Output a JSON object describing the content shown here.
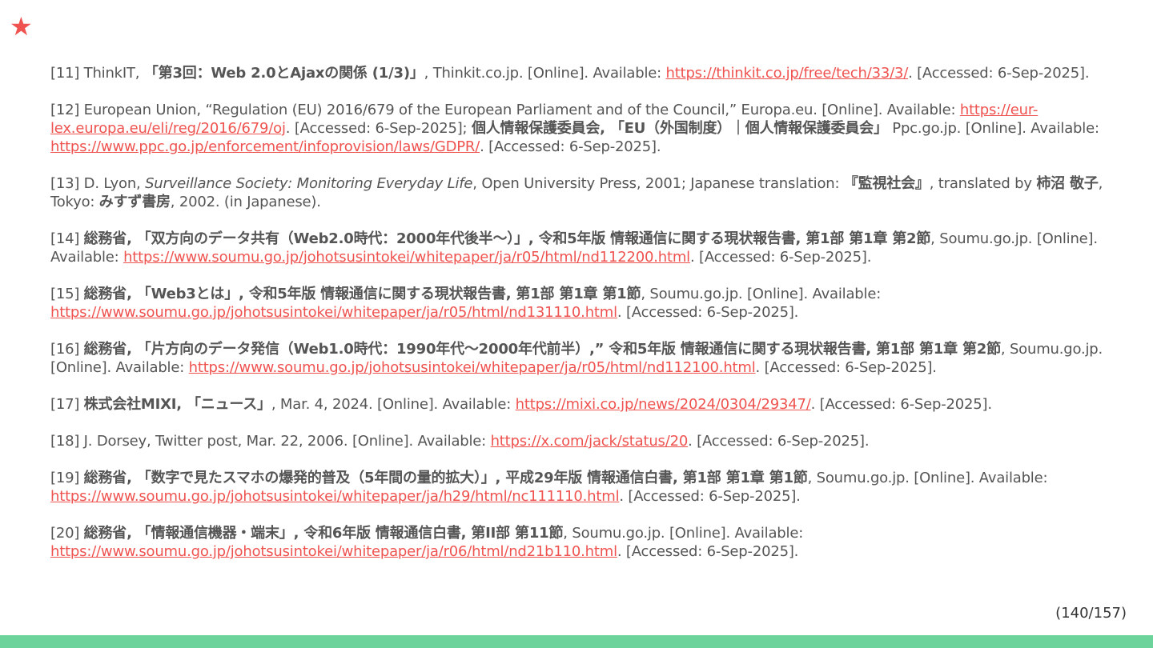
{
  "slide": {
    "star_icon": "★",
    "page_number": "(140/157)",
    "accent_color": "#ef5350",
    "bar_color": "#6cd39b"
  },
  "references": [
    {
      "id": "[11]",
      "parts": [
        {
          "t": "[11] ThinkIT, "
        },
        {
          "t": "「第3回：Web 2.0とAjaxの関係 (1/3)」",
          "s": "b"
        },
        {
          "t": ", Thinkit.co.jp. [Online]. Available: "
        },
        {
          "t": "https://thinkit.co.jp/free/tech/33/3/",
          "s": "link"
        },
        {
          "t": ". [Accessed: 6-Sep-2025]."
        }
      ]
    },
    {
      "id": "[12]",
      "parts": [
        {
          "t": "[12] European Union, “Regulation (EU) 2016/679 of the European Parliament and of the Council,” Europa.eu. [Online]. Available: "
        },
        {
          "t": "https://eur-lex.europa.eu/eli/reg/2016/679/oj",
          "s": "link"
        },
        {
          "t": ". [Accessed: 6-Sep-2025]; "
        },
        {
          "t": "個人情報保護委員会, 「EU（外国制度）｜個人情報保護委員会」",
          "s": "b"
        },
        {
          "t": " Ppc.go.jp. [Online]. Available: "
        },
        {
          "t": "https://www.ppc.go.jp/enforcement/infoprovision/laws/GDPR/",
          "s": "link"
        },
        {
          "t": ". [Accessed: 6-Sep-2025]."
        }
      ]
    },
    {
      "id": "[13]",
      "parts": [
        {
          "t": "[13] D. Lyon, "
        },
        {
          "t": "Surveillance Society: Monitoring Everyday Life",
          "s": "i"
        },
        {
          "t": ", Open University Press, 2001; Japanese translation: "
        },
        {
          "t": "『監視社会』",
          "s": "b"
        },
        {
          "t": ", translated by "
        },
        {
          "t": "柿沼 敬子",
          "s": "b"
        },
        {
          "t": ", Tokyo: "
        },
        {
          "t": "みすず書房",
          "s": "b"
        },
        {
          "t": ", 2002. (in Japanese)."
        }
      ]
    },
    {
      "id": "[14]",
      "parts": [
        {
          "t": "[14] "
        },
        {
          "t": "総務省, 「双方向のデータ共有（Web2.0時代：2000年代後半〜）」, 令和5年版 情報通信に関する現状報告書, 第1部 第1章 第2節",
          "s": "b"
        },
        {
          "t": ", Soumu.go.jp. [Online]. Available: "
        },
        {
          "t": "https://www.soumu.go.jp/johotsusintokei/whitepaper/ja/r05/html/nd112200.html",
          "s": "link"
        },
        {
          "t": ". [Accessed: 6-Sep-2025]."
        }
      ]
    },
    {
      "id": "[15]",
      "parts": [
        {
          "t": "[15] "
        },
        {
          "t": "総務省, 「Web3とは」, 令和5年版 情報通信に関する現状報告書, 第1部 第1章 第1節",
          "s": "b"
        },
        {
          "t": ", Soumu.go.jp. [Online]. Available: "
        },
        {
          "t": "https://www.soumu.go.jp/johotsusintokei/whitepaper/ja/r05/html/nd131110.html",
          "s": "link"
        },
        {
          "t": ". [Accessed: 6-Sep-2025]."
        }
      ]
    },
    {
      "id": "[16]",
      "parts": [
        {
          "t": "[16] "
        },
        {
          "t": "総務省, 「片方向のデータ発信（Web1.0時代：1990年代〜2000年代前半）,” 令和5年版 情報通信に関する現状報告書, 第1部 第1章 第2節",
          "s": "b"
        },
        {
          "t": ", Soumu.go.jp. [Online]. Available: "
        },
        {
          "t": "https://www.soumu.go.jp/johotsusintokei/whitepaper/ja/r05/html/nd112100.html",
          "s": "link"
        },
        {
          "t": ". [Accessed: 6-Sep-2025]."
        }
      ]
    },
    {
      "id": "[17]",
      "parts": [
        {
          "t": "[17] "
        },
        {
          "t": "株式会社MIXI, 「ニュース」",
          "s": "b"
        },
        {
          "t": ", Mar. 4, 2024. [Online]. Available: "
        },
        {
          "t": "https://mixi.co.jp/news/2024/0304/29347/",
          "s": "link"
        },
        {
          "t": ". [Accessed: 6-Sep-2025]."
        }
      ]
    },
    {
      "id": "[18]",
      "parts": [
        {
          "t": "[18] J. Dorsey, Twitter post, Mar. 22, 2006. [Online]. Available: "
        },
        {
          "t": "https://x.com/jack/status/20",
          "s": "link"
        },
        {
          "t": ". [Accessed: 6-Sep-2025]."
        }
      ]
    },
    {
      "id": "[19]",
      "parts": [
        {
          "t": "[19] "
        },
        {
          "t": "総務省, 「数字で見たスマホの爆発的普及（5年間の量的拡大）」, 平成29年版 情報通信白書, 第1部 第1章 第1節",
          "s": "b"
        },
        {
          "t": ", Soumu.go.jp. [Online]. Available: "
        },
        {
          "t": "https://www.soumu.go.jp/johotsusintokei/whitepaper/ja/h29/html/nc111110.html",
          "s": "link"
        },
        {
          "t": ". [Accessed: 6-Sep-2025]."
        }
      ]
    },
    {
      "id": "[20]",
      "parts": [
        {
          "t": "[20] "
        },
        {
          "t": "総務省, 「情報通信機器・端末」, 令和6年版 情報通信白書, 第II部 第11節",
          "s": "b"
        },
        {
          "t": ", Soumu.go.jp. [Online]. Available: "
        },
        {
          "t": "https://www.soumu.go.jp/johotsusintokei/whitepaper/ja/r06/html/nd21b110.html",
          "s": "link"
        },
        {
          "t": ". [Accessed: 6-Sep-2025]."
        }
      ]
    }
  ]
}
